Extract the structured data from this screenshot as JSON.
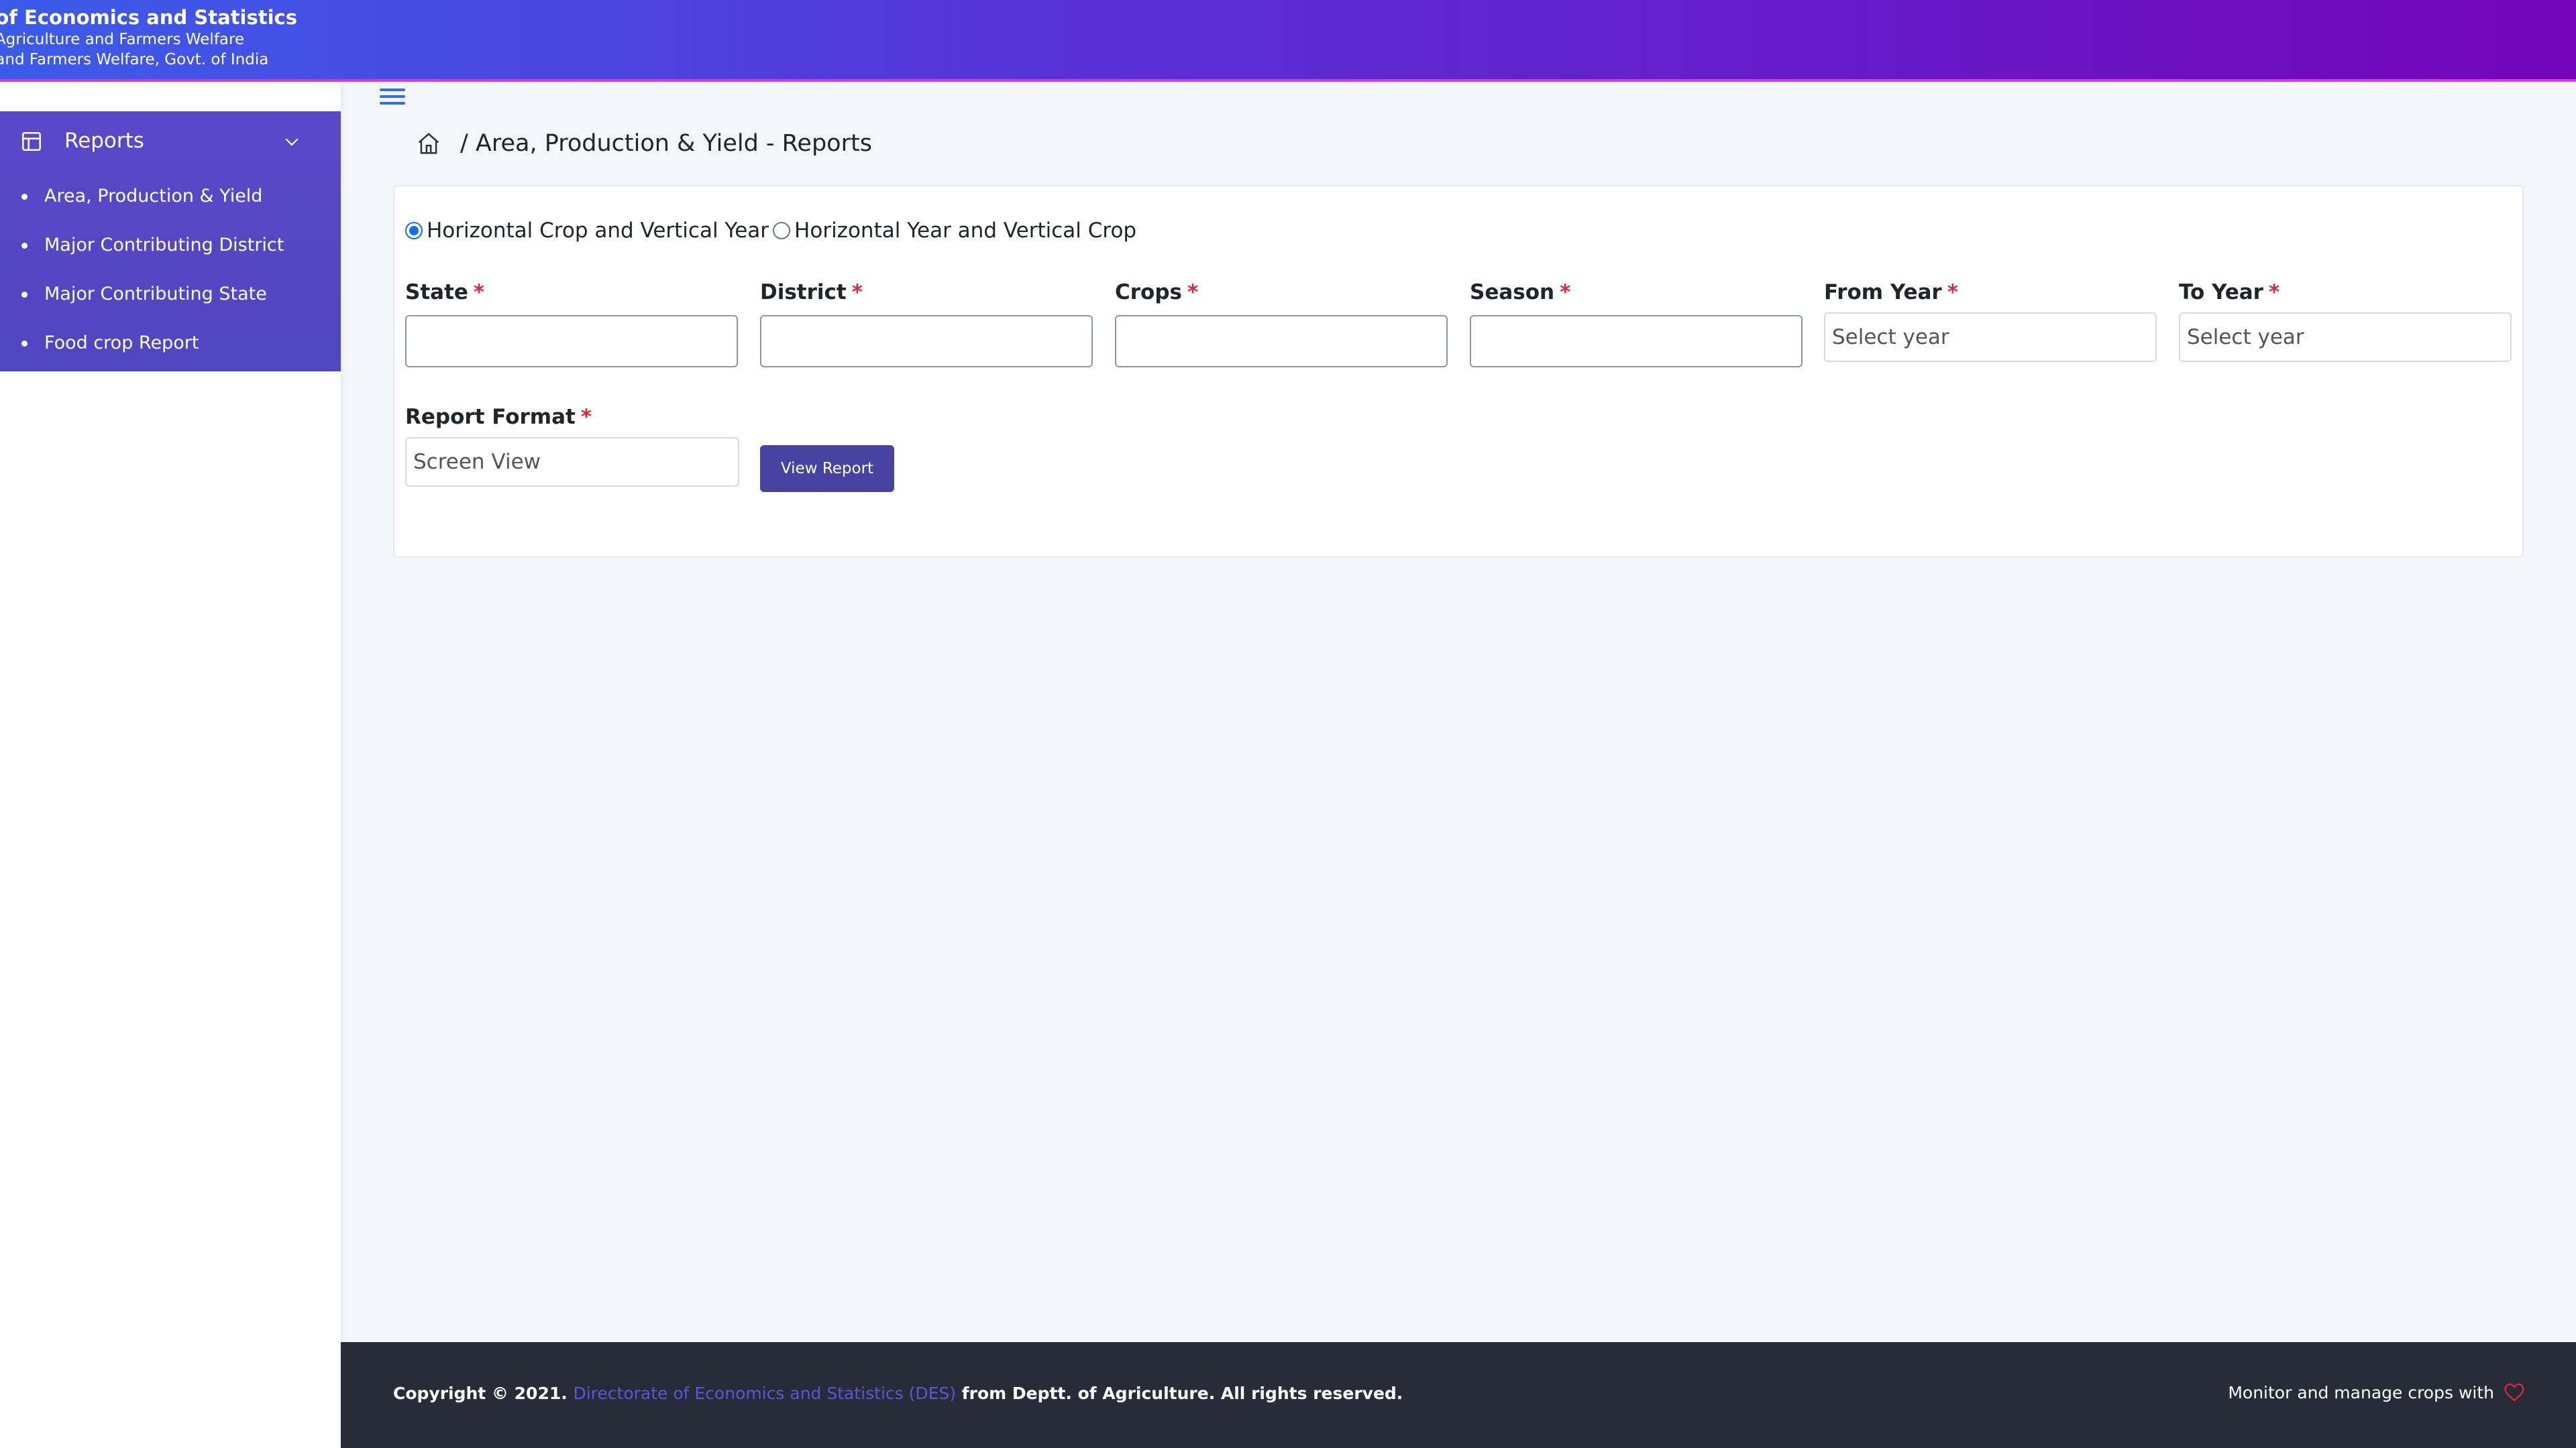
{
  "header": {
    "line1": "orate of Economics and Statistics",
    "line2": "ment of Agriculture and Farmers Welfare",
    "line3": "of Agriculture and Farmers Welfare, Govt. of India"
  },
  "sidebar": {
    "section_label": "Reports",
    "section_icon": "table-layout-icon",
    "items": [
      {
        "label": "Area, Production & Yield"
      },
      {
        "label": "Major Contributing District"
      },
      {
        "label": "Major Contributing State"
      },
      {
        "label": "Food crop Report"
      }
    ]
  },
  "breadcrumb": {
    "home_icon": "home-icon",
    "current": "/ Area, Production & Yield - Reports"
  },
  "form": {
    "orientation": {
      "options": [
        {
          "label": "Horizontal Crop and Vertical Year",
          "checked": true
        },
        {
          "label": "Horizontal Year and Vertical Crop",
          "checked": false
        }
      ]
    },
    "required_marker": "*",
    "fields": {
      "state": {
        "label": "State",
        "value": ""
      },
      "district": {
        "label": "District",
        "value": ""
      },
      "crops": {
        "label": "Crops",
        "value": ""
      },
      "season": {
        "label": "Season",
        "value": ""
      },
      "from_year": {
        "label": "From Year",
        "value": "Select year"
      },
      "to_year": {
        "label": "To Year",
        "value": "Select year"
      },
      "report_format": {
        "label": "Report Format",
        "value": "Screen View"
      }
    },
    "submit_label": "View Report"
  },
  "footer": {
    "copyright_prefix": "Copyright © 2021.",
    "org_link": "Directorate of Economics and Statistics (DES)",
    "copyright_suffix": "from Deptt. of Agriculture. All rights reserved.",
    "tagline": "Monitor and manage crops with"
  },
  "colors": {
    "accent": "#4643a3",
    "sidebar": "#5247c4",
    "required": "#e0243c",
    "footer_bg": "#272c38"
  }
}
